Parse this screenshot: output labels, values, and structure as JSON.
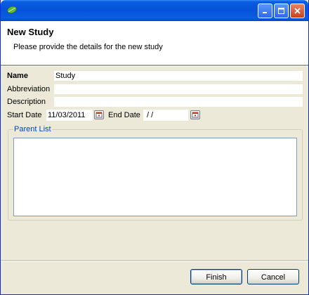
{
  "window": {
    "title": "",
    "icon": "leaf-icon"
  },
  "header": {
    "title": "New Study",
    "subtitle": "Please provide the details for the new study"
  },
  "form": {
    "name_label": "Name",
    "name_value": "Study",
    "abbreviation_label": "Abbreviation",
    "abbreviation_value": "",
    "description_label": "Description",
    "description_value": "",
    "start_date_label": "Start Date",
    "start_date_value": "11/03/2011",
    "end_date_label": "End Date",
    "end_date_value": " / /"
  },
  "parent_list": {
    "label": "Parent List",
    "items": []
  },
  "buttons": {
    "finish": "Finish",
    "cancel": "Cancel"
  },
  "colors": {
    "titlebar": "#0a5de2",
    "group_label": "#0046d5",
    "dialog_bg": "#ece9d8"
  }
}
